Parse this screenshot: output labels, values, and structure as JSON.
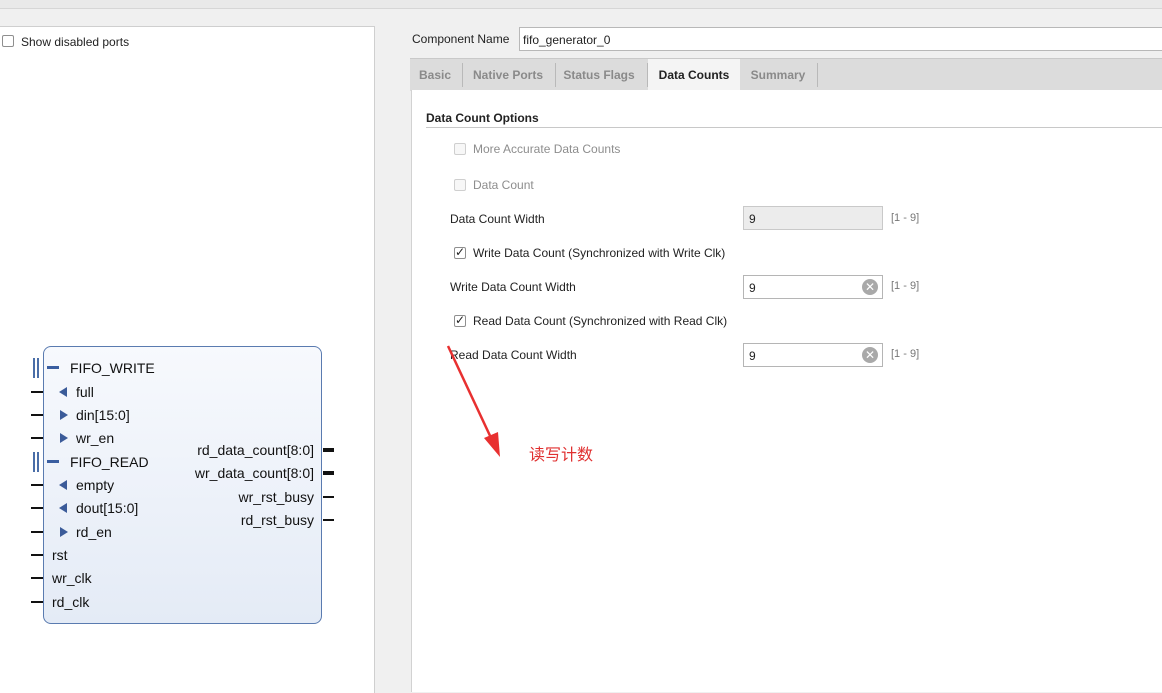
{
  "left_panel": {
    "show_disabled_ports_label": "Show disabled ports",
    "block": {
      "groups": [
        {
          "name": "FIFO_WRITE"
        },
        {
          "name": "FIFO_READ"
        }
      ],
      "left_ports": [
        "full",
        "din[15:0]",
        "wr_en",
        "empty",
        "dout[15:0]",
        "rd_en",
        "rst",
        "wr_clk",
        "rd_clk"
      ],
      "right_ports": [
        "rd_data_count[8:0]",
        "wr_data_count[8:0]",
        "wr_rst_busy",
        "rd_rst_busy"
      ]
    }
  },
  "component": {
    "label": "Component Name",
    "value": "fifo_generator_0"
  },
  "tabs": [
    "Basic",
    "Native Ports",
    "Status Flags",
    "Data Counts",
    "Summary"
  ],
  "active_tab": "Data Counts",
  "section": {
    "title": "Data Count Options",
    "more_accurate_label": "More Accurate Data Counts",
    "data_count_label": "Data Count",
    "data_count_width_label": "Data Count Width",
    "data_count_width_value": "9",
    "write_data_count_label": "Write Data Count (Synchronized with Write Clk)",
    "write_data_count_checked": true,
    "write_width_label": "Write Data Count Width",
    "write_width_value": "9",
    "read_data_count_label": "Read Data Count (Synchronized with Read Clk)",
    "read_data_count_checked": true,
    "read_width_label": "Read Data Count Width",
    "read_width_value": "9",
    "range": "[1 - 9]"
  },
  "annotation": {
    "text": "读写计数",
    "color": "#e03030"
  },
  "colors": {
    "block_border": "#5a7bb0",
    "tab_inactive": "#8a8a8a"
  }
}
